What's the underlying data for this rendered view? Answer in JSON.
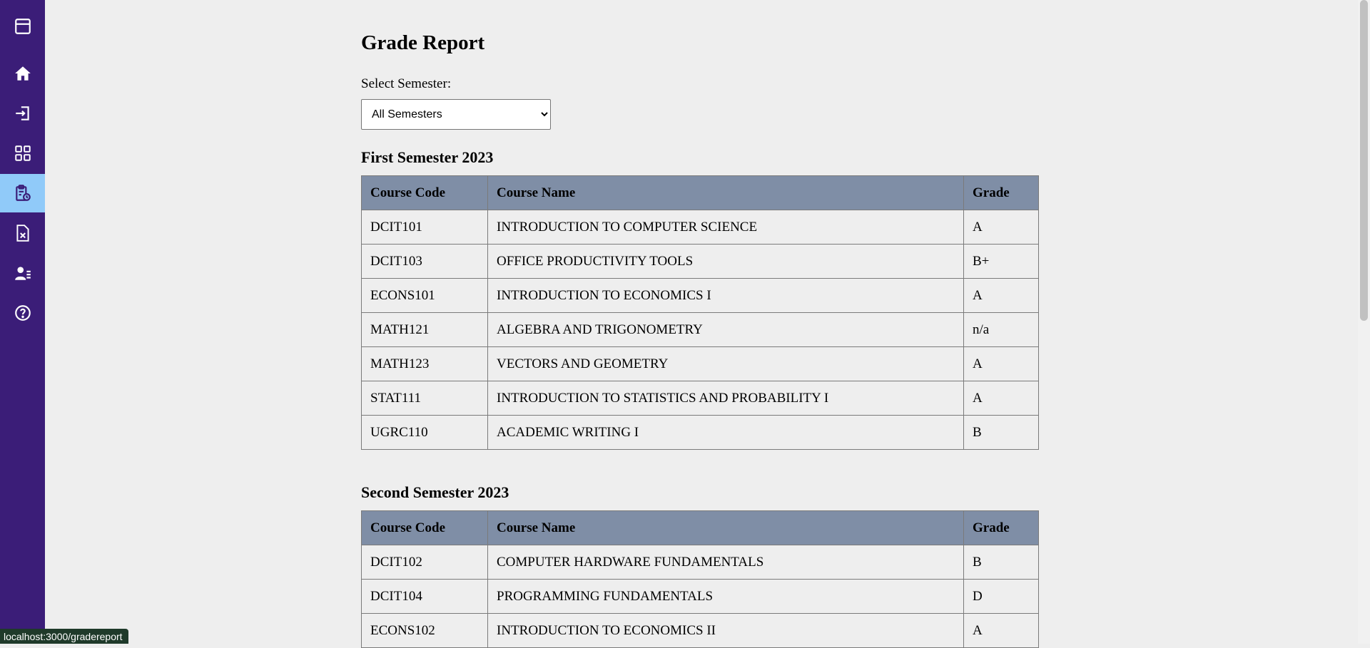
{
  "page": {
    "title": "Grade Report",
    "select_label": "Select Semester:"
  },
  "semester_select": {
    "value": "All Semesters",
    "options": [
      "All Semesters"
    ]
  },
  "sidebar": {
    "items": [
      {
        "icon": "window-icon"
      },
      {
        "icon": "home-icon"
      },
      {
        "icon": "sign-in-icon"
      },
      {
        "icon": "dashboard-grid-icon"
      },
      {
        "icon": "clipboard-clock-icon",
        "active": true
      },
      {
        "icon": "file-x-icon"
      },
      {
        "icon": "user-list-icon"
      },
      {
        "icon": "help-circle-icon"
      }
    ]
  },
  "tables": {
    "headers": {
      "code": "Course Code",
      "name": "Course Name",
      "grade": "Grade"
    }
  },
  "semesters": [
    {
      "title": "First Semester 2023",
      "courses": [
        {
          "code": "DCIT101",
          "name": "INTRODUCTION TO COMPUTER SCIENCE",
          "grade": "A"
        },
        {
          "code": "DCIT103",
          "name": "OFFICE PRODUCTIVITY TOOLS",
          "grade": "B+"
        },
        {
          "code": "ECONS101",
          "name": "INTRODUCTION TO ECONOMICS I",
          "grade": "A"
        },
        {
          "code": "MATH121",
          "name": "ALGEBRA AND TRIGONOMETRY",
          "grade": "n/a"
        },
        {
          "code": "MATH123",
          "name": "VECTORS AND GEOMETRY",
          "grade": "A"
        },
        {
          "code": "STAT111",
          "name": "INTRODUCTION TO STATISTICS AND PROBABILITY I",
          "grade": "A"
        },
        {
          "code": "UGRC110",
          "name": "ACADEMIC WRITING I",
          "grade": "B"
        }
      ]
    },
    {
      "title": "Second Semester 2023",
      "courses": [
        {
          "code": "DCIT102",
          "name": "COMPUTER HARDWARE FUNDAMENTALS",
          "grade": "B"
        },
        {
          "code": "DCIT104",
          "name": "PROGRAMMING FUNDAMENTALS",
          "grade": "D"
        },
        {
          "code": "ECONS102",
          "name": "INTRODUCTION TO ECONOMICS II",
          "grade": "A"
        }
      ]
    }
  ],
  "status_bar": {
    "url": "localhost:3000/gradereport"
  },
  "colors": {
    "sidebar_bg": "#3b1d78",
    "sidebar_active": "#90caf9",
    "table_header": "#7f8ea6",
    "page_bg": "#eeeeee"
  }
}
